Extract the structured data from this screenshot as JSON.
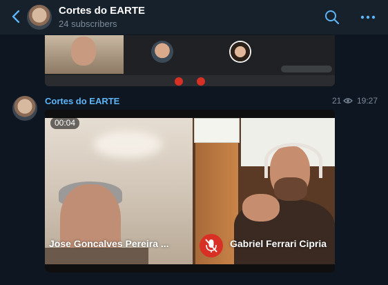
{
  "header": {
    "title": "Cortes do EARTE",
    "subtitle": "24 subscribers"
  },
  "message": {
    "author": "Cortes do EARTE",
    "views": "21",
    "time": "19:27",
    "video": {
      "duration": "00:04",
      "participant_left": "Jose Goncalves Pereira ...",
      "participant_right": "Gabriel Ferrari Cipria"
    }
  },
  "colors": {
    "background": "#0e1621",
    "header_bg": "#17212b",
    "accent": "#5eb5f7",
    "muted": "#7d8b99",
    "mic_red": "#d93025"
  },
  "icons": [
    "back-arrow-icon",
    "search-icon",
    "more-icon",
    "eye-icon",
    "mic-off-icon"
  ]
}
